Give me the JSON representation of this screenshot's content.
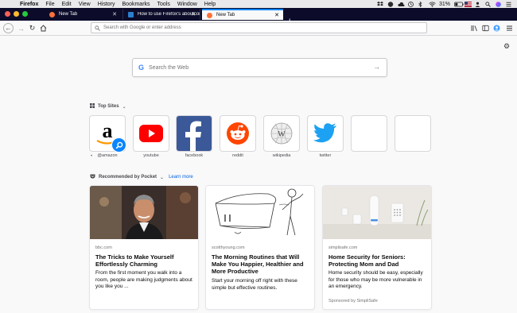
{
  "macos_menubar": {
    "app_name": "Firefox",
    "items": [
      "File",
      "Edit",
      "View",
      "History",
      "Bookmarks",
      "Tools",
      "Window",
      "Help"
    ],
    "battery": "31%"
  },
  "tabs": [
    {
      "label": "New Tab"
    },
    {
      "label": "How to use Firefox's aboutconfi"
    },
    {
      "label": "New Tab"
    }
  ],
  "urlbar": {
    "placeholder": "Search with Google or enter address"
  },
  "search": {
    "placeholder": "Search the Web",
    "provider_logo": "G"
  },
  "top_sites": {
    "heading": "Top Sites",
    "sites": [
      {
        "label": "@amazon"
      },
      {
        "label": "youtube"
      },
      {
        "label": "facebook"
      },
      {
        "label": "reddit"
      },
      {
        "label": "wikipedia"
      },
      {
        "label": "twitter"
      }
    ]
  },
  "pocket": {
    "heading": "Recommended by Pocket",
    "learn_more": "Learn more",
    "cards": [
      {
        "host": "bbc.com",
        "title": "The Tricks to Make Yourself Effortlessly Charming",
        "description": "From the first moment you walk into a room, people are making judgments about you like you ..."
      },
      {
        "host": "scotthyoung.com",
        "title": "The Morning Routines that Will Make You Happier, Healthier and More Productive",
        "description": "Start your morning off right with these simple but effective routines."
      },
      {
        "host": "simplisafe.com",
        "title": "Home Security for Seniors: Protecting Mom and Dad",
        "description": "Home security should be easy, especially for those who may be more vulnerable in an emergency.",
        "sponsor": "Sponsored by SimpliSafe"
      }
    ]
  },
  "colors": {
    "accent": "#0a84ff",
    "tab_strip": "#0c0c2a",
    "link": "#0060df",
    "youtube": "#ff0000",
    "facebook": "#3b5998",
    "reddit": "#ff4500",
    "twitter": "#1da1f2",
    "amazon_orange": "#ff9900"
  }
}
